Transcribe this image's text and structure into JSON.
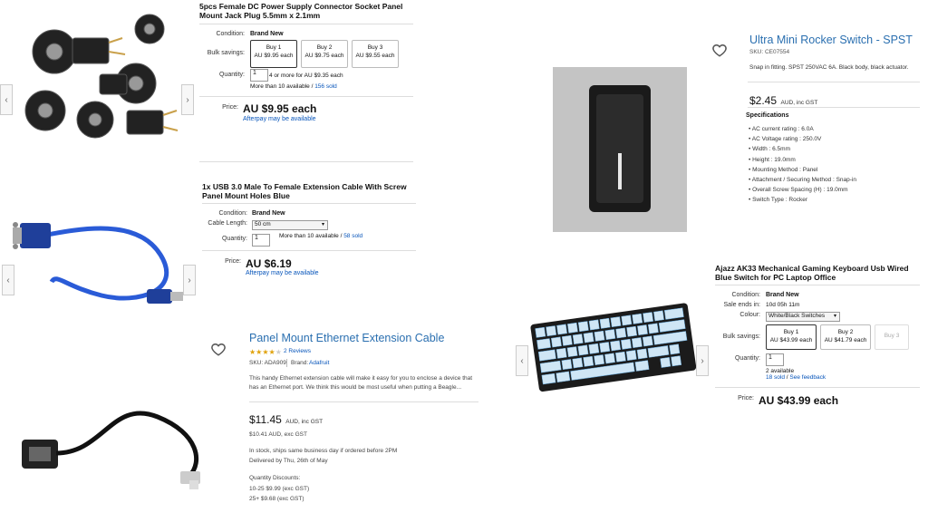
{
  "p1": {
    "title": "5pcs Female DC Power Supply Connector Socket Panel Mount Jack Plug 5.5mm x 2.1mm",
    "condition_label": "Condition:",
    "condition": "Brand New",
    "bulk_label": "Bulk savings:",
    "bulk": [
      {
        "line1": "Buy 1",
        "line2": "AU $9.95 each"
      },
      {
        "line1": "Buy 2",
        "line2": "AU $9.75 each"
      },
      {
        "line1": "Buy 3",
        "line2": "AU $9.55 each"
      }
    ],
    "qty_label": "Quantity:",
    "qty": "1",
    "more_offer": "4 or more for AU $9.35 each",
    "avail": "More than 10 available",
    "sold": "156 sold",
    "price_label": "Price:",
    "price": "AU $9.95 each",
    "afterpay": "Afterpay may be available"
  },
  "p2": {
    "title": "1x USB 3.0 Male To Female Extension Cable With Screw Panel Mount Holes Blue",
    "condition_label": "Condition:",
    "condition": "Brand New",
    "cable_label": "Cable Length:",
    "cable_value": "50 cm",
    "qty_label": "Quantity:",
    "qty": "1",
    "avail": "More than 10 available",
    "sold": "58 sold",
    "price_label": "Price:",
    "price": "AU $6.19",
    "afterpay": "Afterpay may be available"
  },
  "p3": {
    "title": "Ultra Mini Rocker Switch - SPST",
    "sku": "SKU: CE07554",
    "desc": "Snap in fitting. SPST 250VAC 6A. Black body, black actuator.",
    "price": "$2.45",
    "price_note": "AUD, inc GST",
    "spec_heading": "Specifications",
    "specs": [
      "AC current rating : 6.0A",
      "AC Voltage rating : 250.0V",
      "Width : 6.5mm",
      "Height : 19.0mm",
      "Mounting Method : Panel",
      "Attachment / Securing Method : Snap-in",
      "Overall Screw Spacing (H) : 19.0mm",
      "Switch Type : Rocker"
    ]
  },
  "p4": {
    "title": "Panel Mount Ethernet Extension Cable",
    "reviews": "2 Reviews",
    "sku": "SKU: ADA909",
    "brand_label": "Brand:",
    "brand": "Adafruit",
    "desc": "This handy Ethernet extension cable will make it easy for you to enclose a device that has an Ethernet port. We think this would be most useful when putting a Beagle...",
    "price": "$11.45",
    "price_note": "AUD, inc GST",
    "price_ex": "$10.41 AUD, exc GST",
    "stock1": "In stock, ships same business day if ordered before 2PM",
    "stock2": "Delivered by Thu, 26th of May",
    "disc_heading": "Quantity Discounts:",
    "disc1": "10-25 $9.99 (exc GST)",
    "disc2": "25+ $9.68 (exc GST)",
    "rating": 4
  },
  "p5": {
    "title": "Ajazz AK33 Mechanical Gaming Keyboard Usb Wired Blue Switch for PC Laptop Office",
    "condition_label": "Condition:",
    "condition": "Brand New",
    "sale_label": "Sale ends in:",
    "sale": "10d 05h 11m",
    "colour_label": "Colour:",
    "colour": "White/Black Switches",
    "bulk_label": "Bulk savings:",
    "bulk": [
      {
        "line1": "Buy 1",
        "line2": "AU $43.99 each"
      },
      {
        "line1": "Buy 2",
        "line2": "AU $41.79 each"
      },
      {
        "line1": "Buy 3",
        "line2": ""
      }
    ],
    "qty_label": "Quantity:",
    "qty": "1",
    "avail": "2 available",
    "sold": "18 sold",
    "feedback": "See feedback",
    "price_label": "Price:",
    "price": "AU $43.99 each"
  }
}
